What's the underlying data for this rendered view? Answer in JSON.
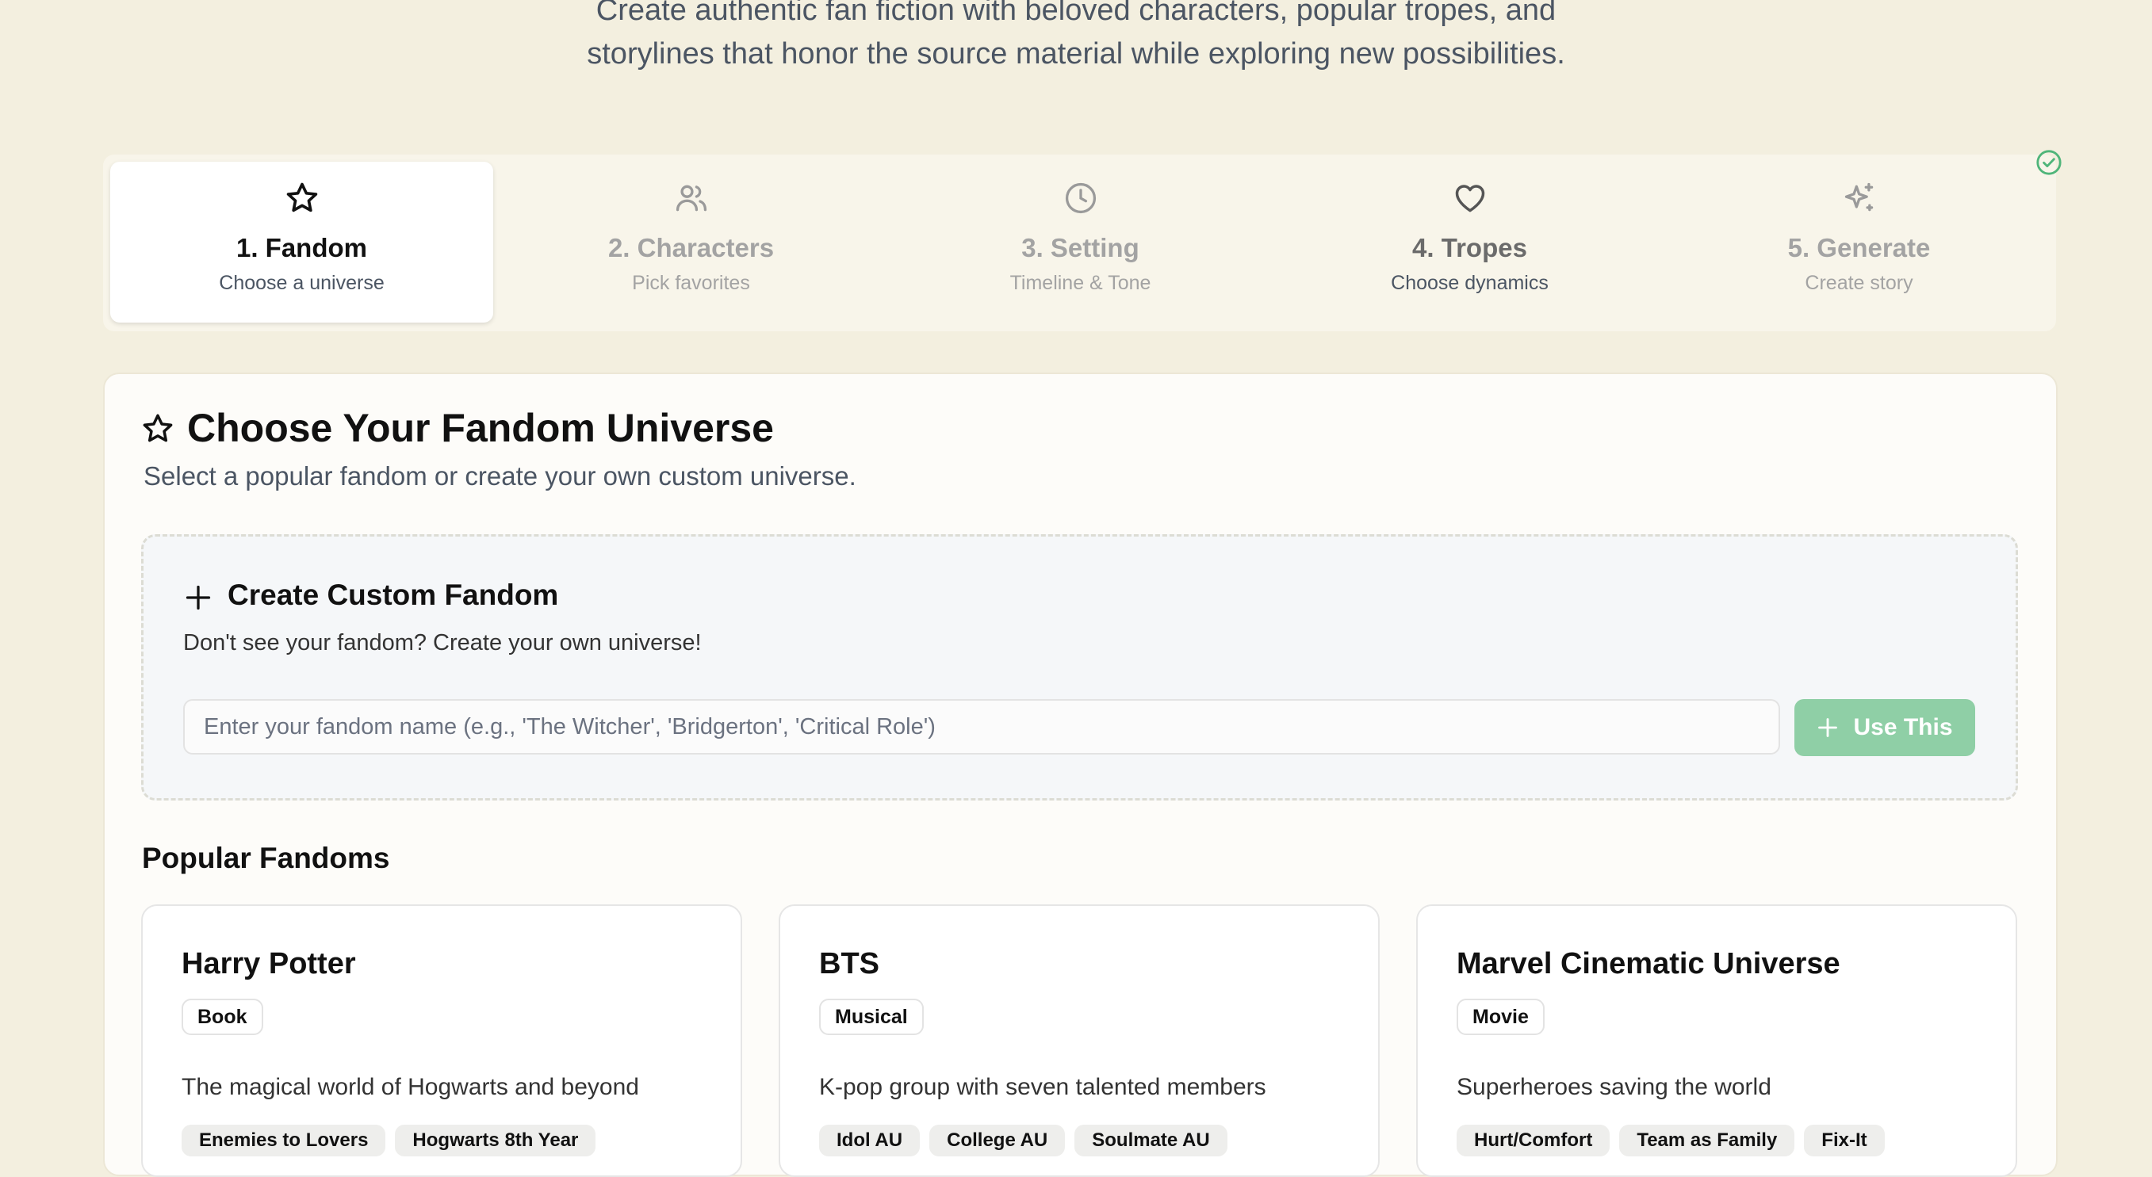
{
  "header": {
    "subtitle_line1": "Create authentic fan fiction with beloved characters, popular tropes, and",
    "subtitle_line2": "storylines that honor the source material while exploring new possibilities."
  },
  "steps": [
    {
      "title": "1. Fandom",
      "sub": "Choose a universe",
      "icon": "star-icon",
      "state": "active"
    },
    {
      "title": "2. Characters",
      "sub": "Pick favorites",
      "icon": "users-icon",
      "state": "inactive"
    },
    {
      "title": "3. Setting",
      "sub": "Timeline & Tone",
      "icon": "clock-icon",
      "state": "inactive"
    },
    {
      "title": "4. Tropes",
      "sub": "Choose dynamics",
      "icon": "heart-icon",
      "state": "partial"
    },
    {
      "title": "5. Generate",
      "sub": "Create story",
      "icon": "sparkles-icon",
      "state": "inactive"
    }
  ],
  "section": {
    "title": "Choose Your Fandom Universe",
    "description": "Select a popular fandom or create your own custom universe."
  },
  "custom": {
    "title": "Create Custom Fandom",
    "description": "Don't see your fandom? Create your own universe!",
    "placeholder": "Enter your fandom name (e.g., 'The Witcher', 'Bridgerton', 'Critical Role')",
    "button": "Use This"
  },
  "popular": {
    "title": "Popular Fandoms",
    "cards": [
      {
        "name": "Harry Potter",
        "badge": "Book",
        "description": "The magical world of Hogwarts and beyond",
        "tags": [
          "Enemies to Lovers",
          "Hogwarts 8th Year"
        ]
      },
      {
        "name": "BTS",
        "badge": "Musical",
        "description": "K-pop group with seven talented members",
        "tags": [
          "Idol AU",
          "College AU",
          "Soulmate AU"
        ]
      },
      {
        "name": "Marvel Cinematic Universe",
        "badge": "Movie",
        "description": "Superheroes saving the world",
        "tags": [
          "Hurt/Comfort",
          "Team as Family",
          "Fix-It"
        ]
      }
    ]
  },
  "colors": {
    "background": "#f3efdf",
    "accent_green": "#8fcfa6",
    "check_green": "#4fb57a"
  }
}
